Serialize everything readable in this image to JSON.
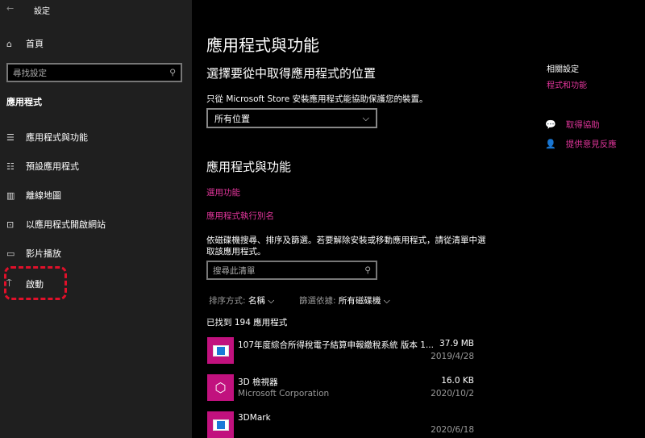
{
  "window": {
    "title": "設定"
  },
  "sidebar": {
    "home": "首頁",
    "search_placeholder": "尋找設定",
    "section": "應用程式",
    "items": [
      {
        "label": "應用程式與功能",
        "icon": "list-icon"
      },
      {
        "label": "預設應用程式",
        "icon": "default-apps-icon"
      },
      {
        "label": "離線地圖",
        "icon": "map-icon"
      },
      {
        "label": "以應用程式開啟網站",
        "icon": "open-website-icon"
      },
      {
        "label": "影片播放",
        "icon": "video-icon"
      },
      {
        "label": "啟動",
        "icon": "startup-icon"
      }
    ],
    "highlight_color": "#e0102a"
  },
  "main": {
    "title": "應用程式與功能",
    "location_heading": "選擇要從中取得應用程式的位置",
    "location_desc": "只從 Microsoft Store 安裝應用程式能協助保護您的裝置。",
    "location_value": "所有位置",
    "apps_heading": "應用程式與功能",
    "link_optional": "選用功能",
    "link_alias": "應用程式執行別名",
    "filter_desc": "依磁碟機搜尋、排序及篩選。若要解除安裝或移動應用程式，請從清單中選取該應用程式。",
    "list_search_placeholder": "搜尋此清單",
    "sort_label": "排序方式:",
    "sort_value": "名稱",
    "filter_label": "篩選依據:",
    "filter_value": "所有磁碟機",
    "found": "已找到 194 應用程式",
    "apps": [
      {
        "name": "107年度綜合所得稅電子結算申報繳稅系統 版本 1...",
        "publisher": "",
        "size": "37.9 MB",
        "date": "2019/4/28",
        "icon": "window-app-icon"
      },
      {
        "name": "3D 檢視器",
        "publisher": "Microsoft Corporation",
        "size": "16.0 KB",
        "date": "2020/10/2",
        "icon": "cube-icon"
      },
      {
        "name": "3DMark",
        "publisher": "",
        "size": "",
        "date": "2020/6/18",
        "icon": "window-app-icon"
      }
    ]
  },
  "related": {
    "heading": "相關設定",
    "link": "程式和功能",
    "help": "取得協助",
    "feedback": "提供意見反應"
  },
  "accent": "#c1117e"
}
